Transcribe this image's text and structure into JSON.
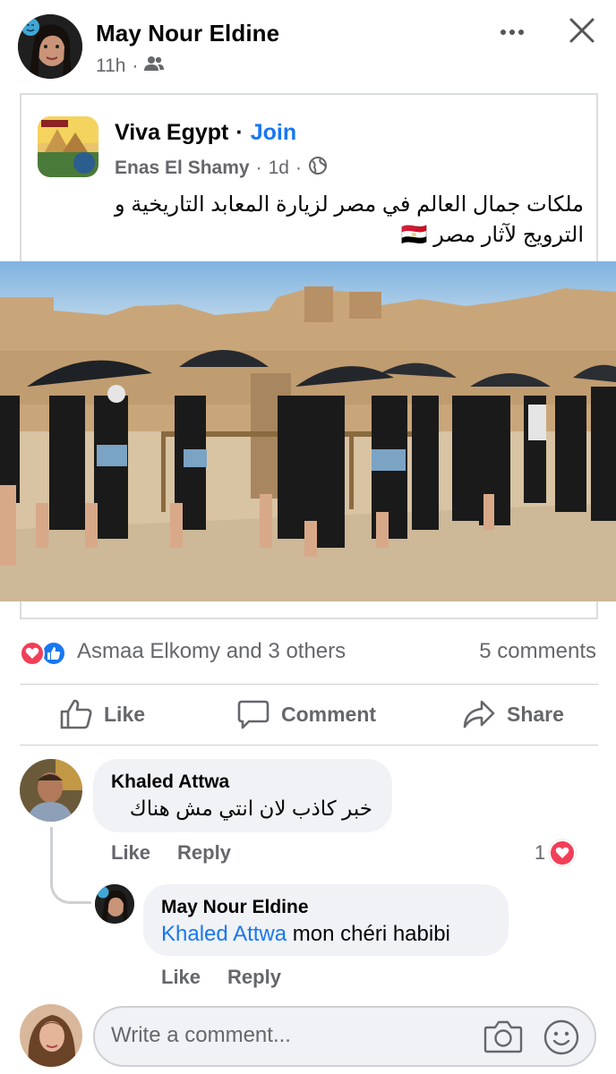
{
  "post": {
    "author": "May Nour Eldine",
    "time": "11h",
    "separator": "·",
    "audience_icon": "friends-icon"
  },
  "shared": {
    "group_name": "Viva Egypt",
    "separator": "·",
    "join_label": "Join",
    "poster": "Enas El Shamy",
    "time": "1d",
    "audience_icon": "globe-icon",
    "text_line1": "ملكات جمال العالم في مصر لزيارة المعابد التاريخية و",
    "text_line2": "الترويج لآثار مصر 🇪🇬"
  },
  "reactions": {
    "icons": [
      "love-icon",
      "like-icon"
    ],
    "summary": "Asmaa Elkomy and 3 others",
    "comments_count": "5 comments"
  },
  "actions": {
    "like_label": "Like",
    "comment_label": "Comment",
    "share_label": "Share"
  },
  "comments": [
    {
      "author": "Khaled Attwa",
      "text": "خبر كاذب لان انتي مش هناك",
      "like_label": "Like",
      "reply_label": "Reply",
      "reaction_count": "1",
      "reaction_icon": "love-icon"
    },
    {
      "author": "May Nour Eldine",
      "mention": "Khaled Attwa",
      "text": "mon chéri habibi",
      "like_label": "Like",
      "reply_label": "Reply"
    }
  ],
  "composer": {
    "placeholder": "Write a comment...",
    "icons": [
      "camera-icon",
      "emoji-icon"
    ]
  },
  "colors": {
    "link_blue": "#1877f2",
    "love_red": "#f33e58",
    "meta_gray": "#65676b",
    "bubble_bg": "#f0f2f5"
  }
}
